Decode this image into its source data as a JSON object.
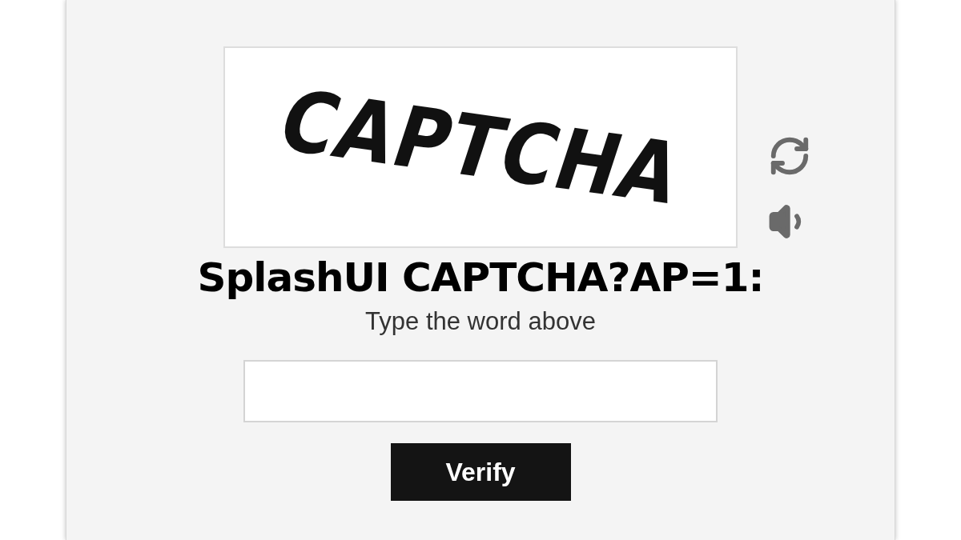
{
  "captcha": {
    "text": "CAPTCHA"
  },
  "title": "SplashUI CAPTCHA?AP=1:",
  "prompt": "Type the word above",
  "button": {
    "label": "Verify"
  }
}
